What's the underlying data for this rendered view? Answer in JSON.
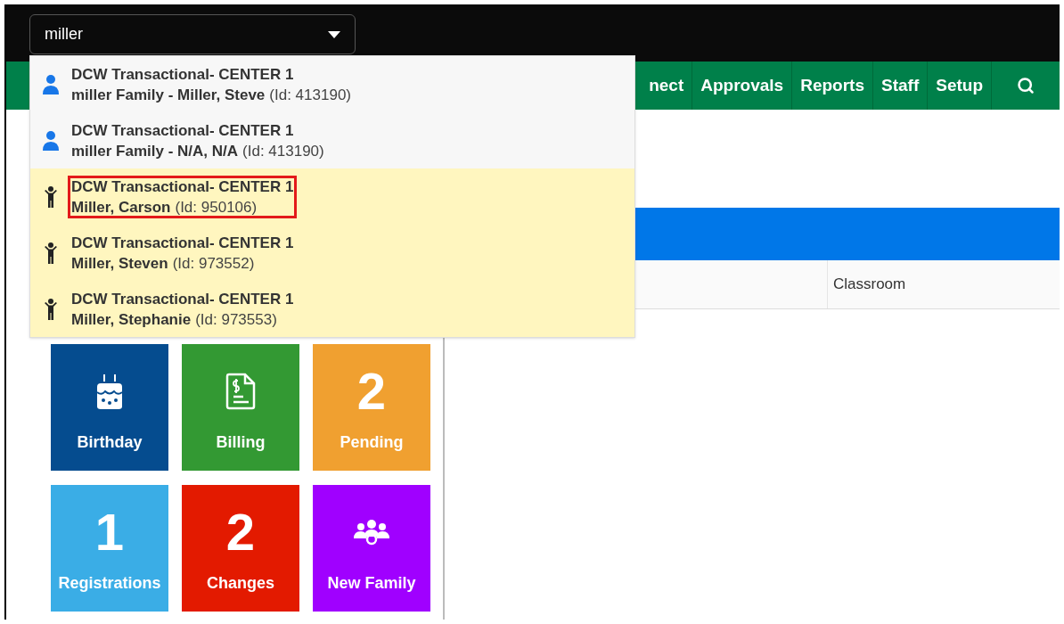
{
  "search": {
    "value": "miller"
  },
  "nav": {
    "items": [
      {
        "label": "nect"
      },
      {
        "label": "Approvals"
      },
      {
        "label": "Reports"
      },
      {
        "label": "Staff"
      },
      {
        "label": "Setup"
      }
    ]
  },
  "results": [
    {
      "kind": "family",
      "center": "DCW Transactional- CENTER 1",
      "name": "miller Family - Miller, Steve",
      "id": "(Id: 413190)",
      "highlighted": false
    },
    {
      "kind": "family",
      "center": "DCW Transactional- CENTER 1",
      "name": "miller Family - N/A, N/A",
      "id": "(Id: 413190)",
      "highlighted": false
    },
    {
      "kind": "child",
      "center": "DCW Transactional- CENTER 1",
      "name": "Miller, Carson",
      "id": "(Id: 950106)",
      "highlighted": true
    },
    {
      "kind": "child",
      "center": "DCW Transactional- CENTER 1",
      "name": "Miller, Steven",
      "id": "(Id: 973552)",
      "highlighted": false
    },
    {
      "kind": "child",
      "center": "DCW Transactional- CENTER 1",
      "name": "Miller, Stephanie",
      "id": "(Id: 973553)",
      "highlighted": false
    }
  ],
  "tiles": [
    {
      "kind": "cake",
      "label": "Birthday",
      "color": "#054c8f"
    },
    {
      "kind": "invoice",
      "label": "Billing",
      "color": "#339933"
    },
    {
      "kind": "count",
      "count": "2",
      "label": "Pending",
      "color": "#f0a030"
    },
    {
      "kind": "count",
      "count": "1",
      "label": "Registrations",
      "color": "#3aade6"
    },
    {
      "kind": "count",
      "count": "2",
      "label": "Changes",
      "color": "#e31a00"
    },
    {
      "kind": "group",
      "label": "New Family",
      "color": "#a000ff"
    }
  ],
  "table": {
    "columns": [
      {
        "label": "Classroom"
      }
    ]
  }
}
